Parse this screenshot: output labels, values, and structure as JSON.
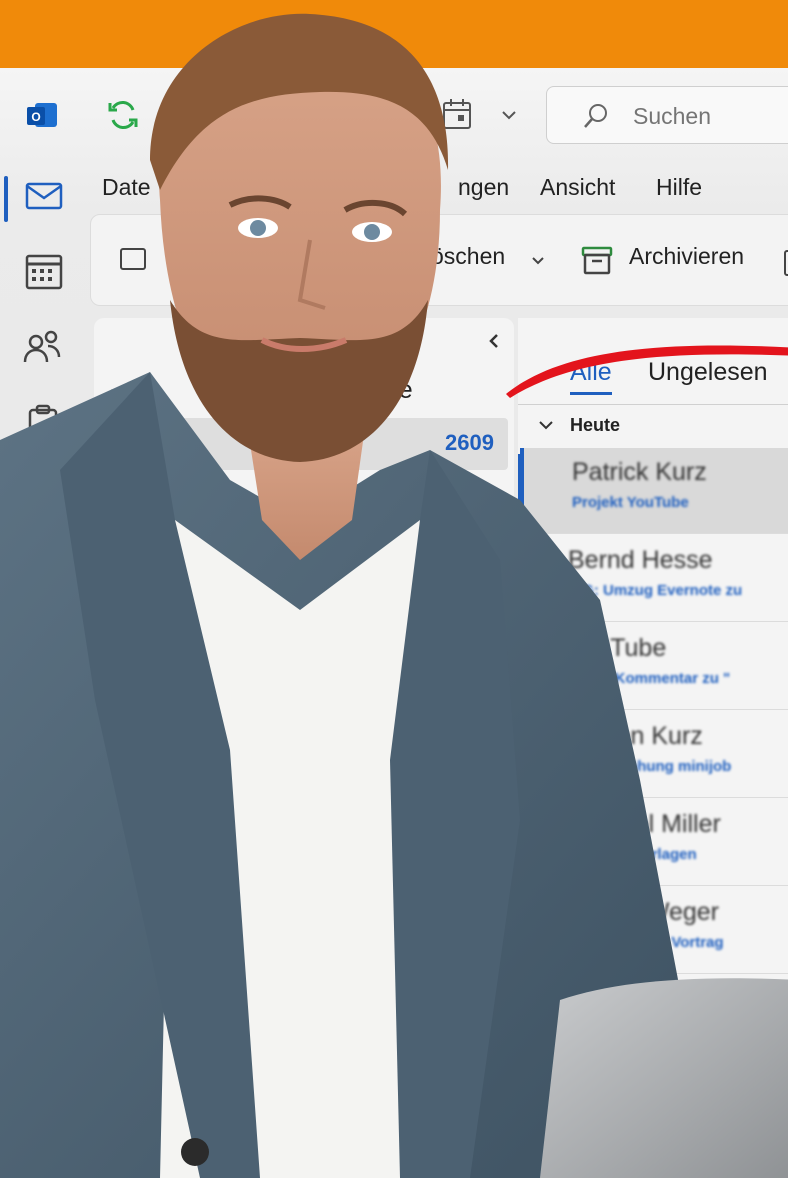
{
  "colors": {
    "banner": "#f08a0a",
    "accent": "#1f5fbf",
    "swoosh": "#e3141c"
  },
  "search": {
    "placeholder": "Suchen"
  },
  "menu": {
    "file": "Date",
    "settings": "ngen",
    "view": "Ansicht",
    "help": "Hilfe"
  },
  "ribbon": {
    "delete": "öschen",
    "archive": "Archivieren"
  },
  "icons": [
    "outlook-app-icon",
    "sync-icon",
    "calendar-icon",
    "mail-icon",
    "people-icon",
    "tasks-icon",
    "search-icon",
    "archive-icon",
    "chevron-down-icon"
  ],
  "folders": {
    "account": "h.de",
    "unread_count": "2609"
  },
  "list": {
    "tabs": {
      "all": "Alle",
      "unread": "Ungelesen"
    },
    "group": "Heute",
    "items": [
      {
        "sender": "Patrick Kurz",
        "subject": "Projekt YouTube"
      },
      {
        "sender": "Bernd Hesse",
        "subject": "WG: Umzug Evernote zu"
      },
      {
        "sender": "YouTube",
        "subject": "Neuer Kommentar zu \""
      },
      {
        "sender": "Jürgen Kurz",
        "subject": "Preiserhöhung minijob"
      },
      {
        "sender": "Michael Miller",
        "subject": "Wohnort Vorlagen"
      },
      {
        "sender": "Daniel Weger",
        "subject": "Einladung mit Vortrag"
      }
    ]
  }
}
